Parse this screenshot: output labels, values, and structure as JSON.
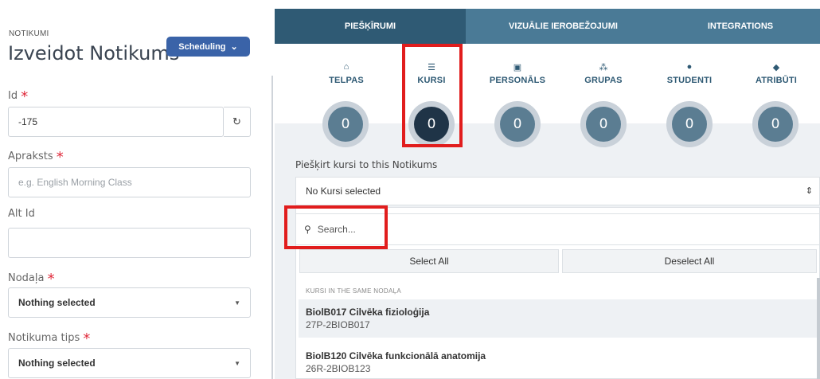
{
  "left": {
    "breadcrumb": "NOTIKUMI",
    "title": "Izveidot Notikums",
    "scheduling_btn": "Scheduling",
    "fields": {
      "id_label": "Id",
      "id_value": "-175",
      "apraksts_label": "Apraksts",
      "apraksts_placeholder": "e.g. English Morning Class",
      "altid_label": "Alt Id",
      "altid_value": "",
      "nodala_label": "Nodaļa",
      "nodala_value": "Nothing selected",
      "tips_label": "Notikuma tips",
      "tips_value": "Nothing selected"
    },
    "required_mark": "*"
  },
  "tabs": [
    "PIEŠĶĪRUMI",
    "VIZUĀLIE IEROBEŽOJUMI",
    "INTEGRATIONS"
  ],
  "categories": [
    {
      "name": "TELPAS",
      "icon": "home-icon",
      "glyph": "⌂",
      "count": "0"
    },
    {
      "name": "KURSI",
      "icon": "list-icon",
      "glyph": "☰",
      "count": "0"
    },
    {
      "name": "PERSONĀLS",
      "icon": "id-card-icon",
      "glyph": "▣",
      "count": "0"
    },
    {
      "name": "GRUPAS",
      "icon": "group-icon",
      "glyph": "⁂",
      "count": "0"
    },
    {
      "name": "STUDENTI",
      "icon": "user-icon",
      "glyph": "●",
      "count": "0"
    },
    {
      "name": "ATRIBŪTI",
      "icon": "tag-icon",
      "glyph": "◆",
      "count": "0"
    }
  ],
  "assign": {
    "label": "Piešķirt kursi to this Notikums",
    "select_value": "No Kursi selected",
    "search_placeholder": "Search...",
    "select_all": "Select All",
    "deselect_all": "Deselect All",
    "group_header": "KURSI IN THE SAME NODAĻA",
    "items": [
      {
        "title": "BiolB017 Cilvēka fizioloģija",
        "code": "27P-2BIOB017"
      },
      {
        "title": "BiolB120 Cilvēka funkcionālā anatomija",
        "code": "26R-2BIOB123"
      }
    ]
  },
  "colors": {
    "accent": "#3a63a8",
    "tab_active": "#2f5a74",
    "tab_inactive": "#4a7a96",
    "highlight_box": "#e11d1d",
    "required": "#e02a3b"
  }
}
